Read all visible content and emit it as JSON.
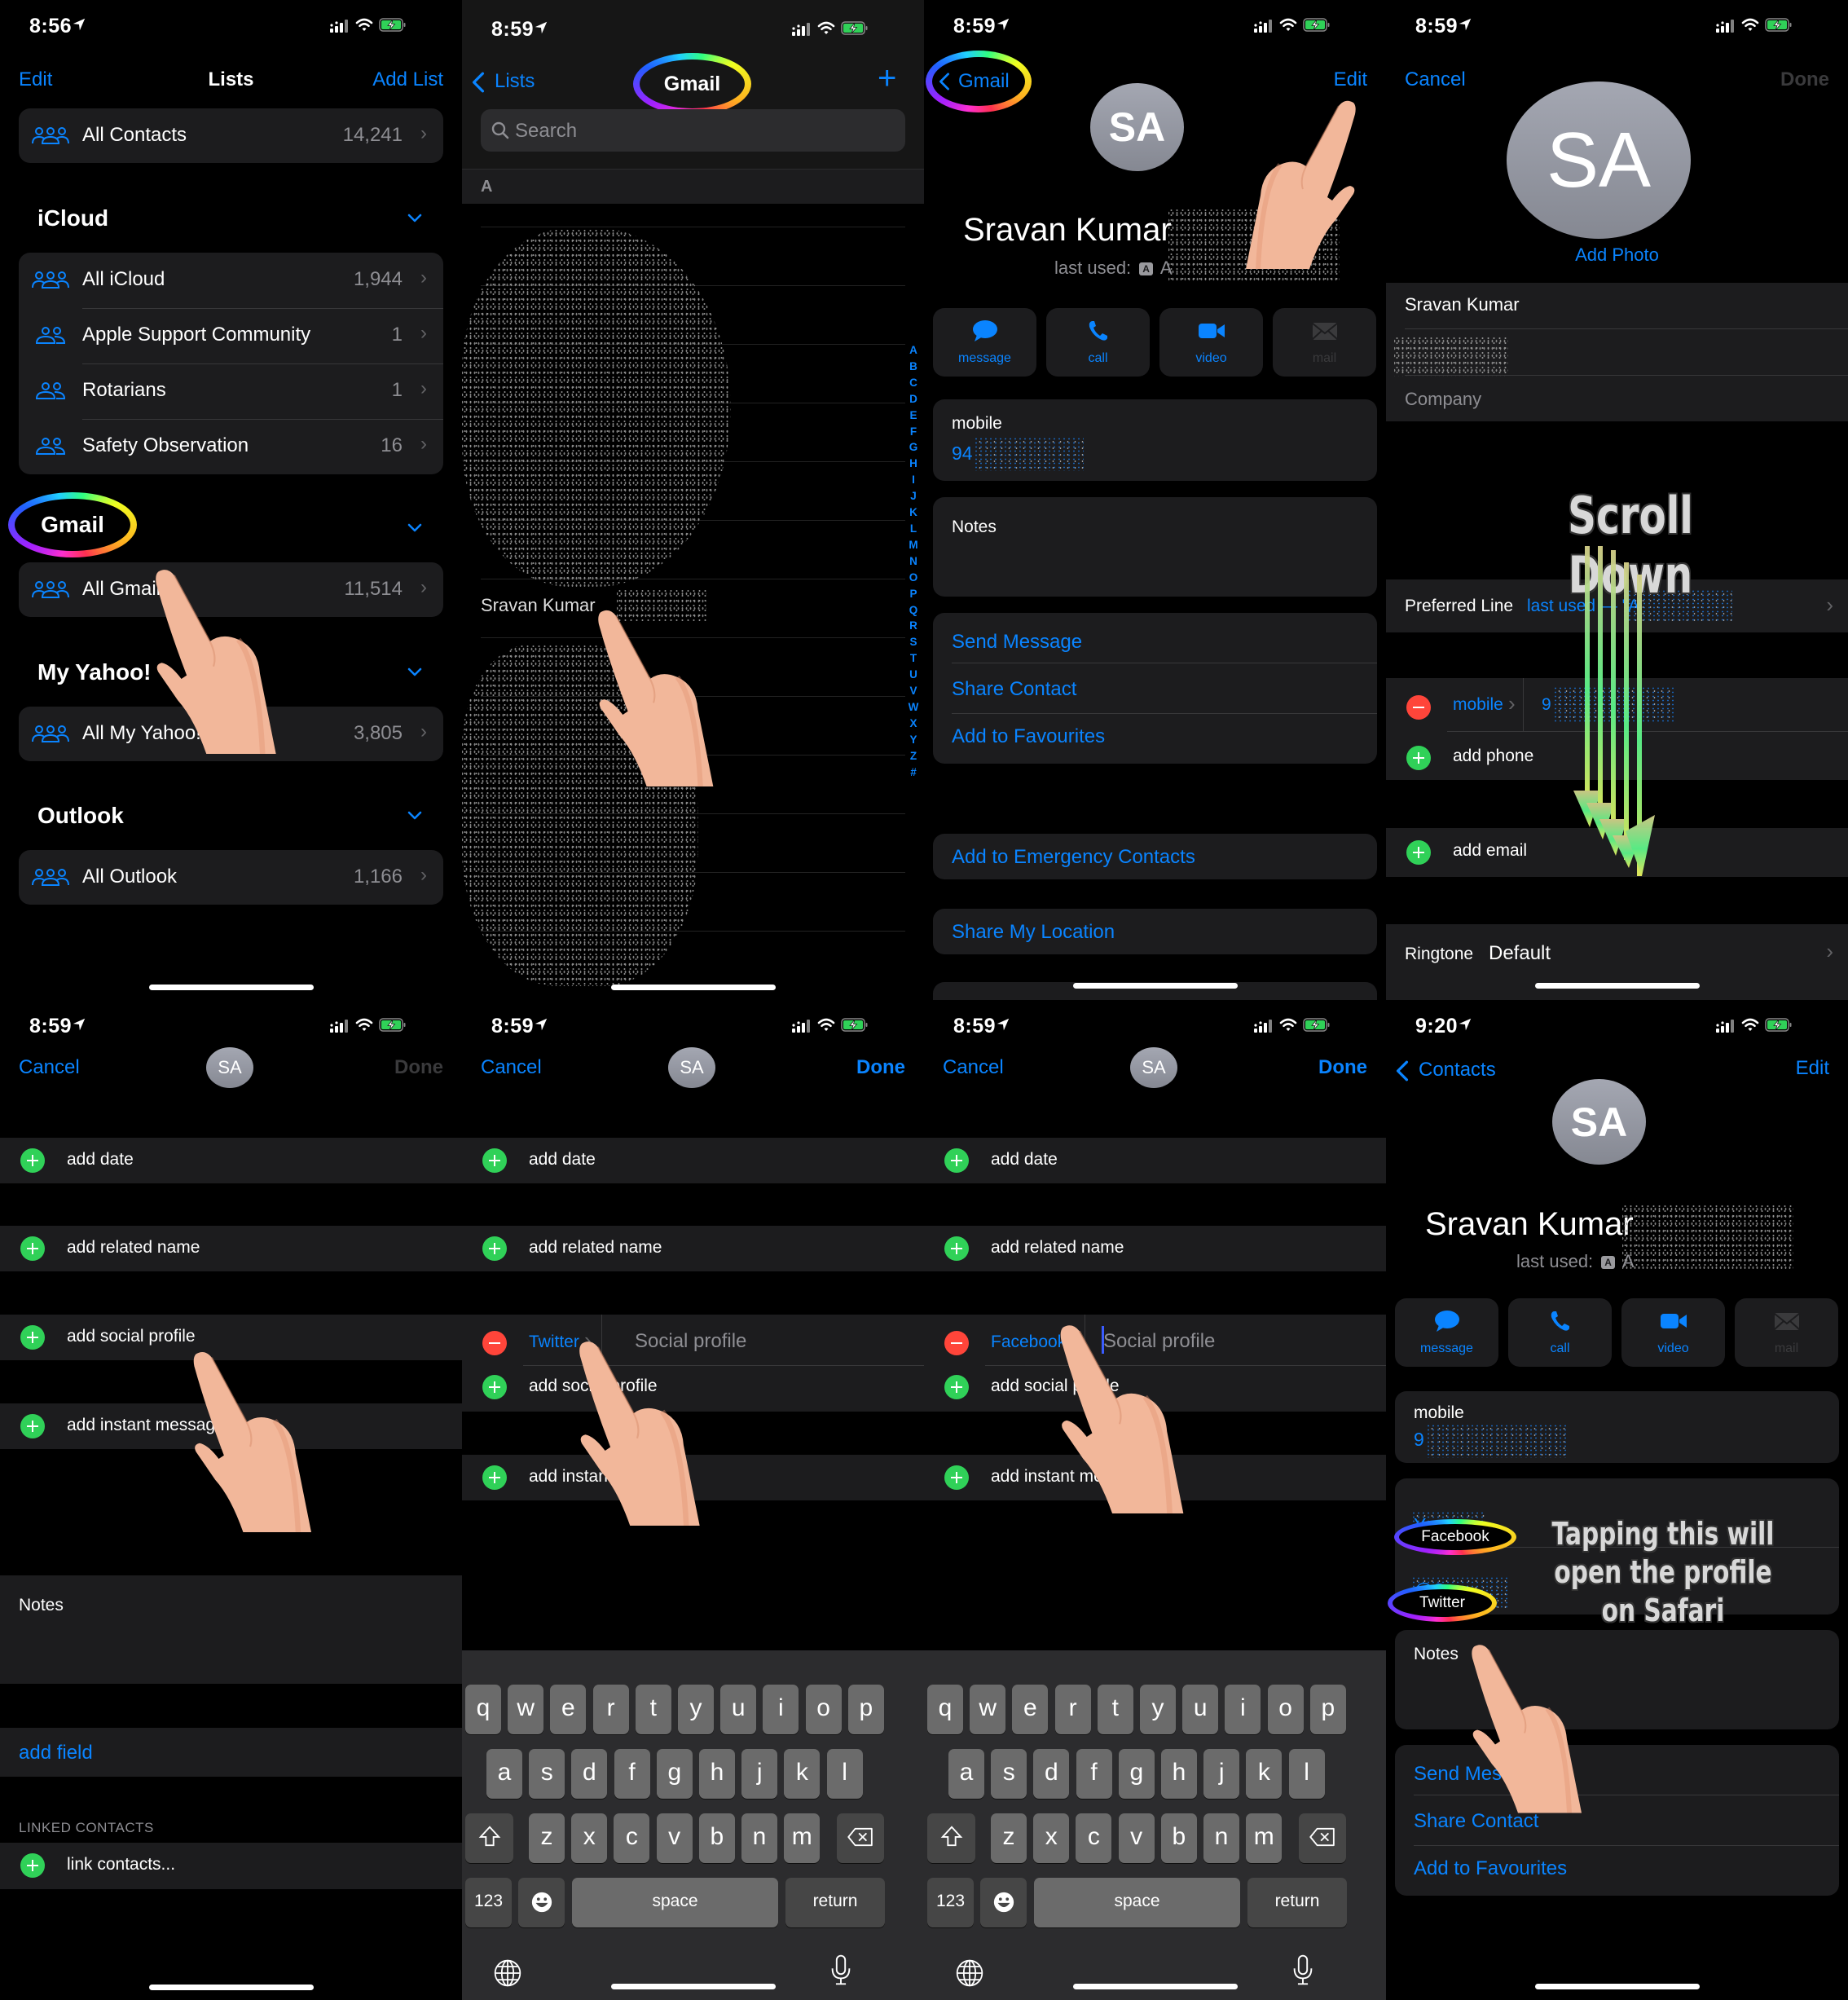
{
  "status_icons": [
    "location-arrow-icon",
    "cellular-signal-icon",
    "wifi-icon",
    "battery-charging-icon"
  ],
  "panel1": {
    "time": "8:56",
    "nav": {
      "left": "Edit",
      "title": "Lists",
      "right": "Add List"
    },
    "top_list": {
      "label": "All Contacts",
      "count": "14,241"
    },
    "sections": [
      {
        "title": "iCloud",
        "items": [
          {
            "label": "All iCloud",
            "count": "1,944",
            "icon": "group-icon"
          },
          {
            "label": "Apple Support Community",
            "count": "1",
            "icon": "group-icon"
          },
          {
            "label": "Rotarians",
            "count": "1",
            "icon": "group-icon"
          },
          {
            "label": "Safety Observation",
            "count": "16",
            "icon": "group-icon"
          }
        ]
      },
      {
        "title": "Gmail",
        "highlighted": true,
        "items": [
          {
            "label": "All Gmail",
            "count": "11,514",
            "icon": "group-icon"
          }
        ]
      },
      {
        "title": "My Yahoo!",
        "items": [
          {
            "label": "All My Yahoo!",
            "count": "3,805",
            "icon": "group-icon"
          }
        ]
      },
      {
        "title": "Outlook",
        "items": [
          {
            "label": "All Outlook",
            "count": "1,166",
            "icon": "group-icon"
          }
        ]
      }
    ]
  },
  "panel2": {
    "time": "8:59",
    "nav": {
      "back": "Lists",
      "title": "Gmail",
      "add": "+"
    },
    "search_placeholder": "Search",
    "section_letter": "A",
    "highlighted_contact": "Sravan Kumar",
    "index_letters": [
      "A",
      "B",
      "C",
      "D",
      "E",
      "F",
      "G",
      "H",
      "I",
      "J",
      "K",
      "L",
      "M",
      "N",
      "O",
      "P",
      "Q",
      "R",
      "S",
      "T",
      "U",
      "V",
      "W",
      "X",
      "Y",
      "Z",
      "#"
    ]
  },
  "panel3": {
    "time": "8:59",
    "nav": {
      "back": "Gmail",
      "right": "Edit"
    },
    "avatar_initials": "SA",
    "name": "Sravan Kumar",
    "last_used_label": "last used:",
    "last_used_badge": "A",
    "last_used_value": "A",
    "actions": [
      {
        "label": "message",
        "icon": "message-bubble-icon",
        "enabled": true
      },
      {
        "label": "call",
        "icon": "phone-icon",
        "enabled": true
      },
      {
        "label": "video",
        "icon": "video-camera-icon",
        "enabled": true
      },
      {
        "label": "mail",
        "icon": "envelope-icon",
        "enabled": false
      }
    ],
    "phone_label": "mobile",
    "phone_value_visible": "94",
    "notes_label": "Notes",
    "links_group1": [
      "Send Message",
      "Share Contact",
      "Add to Favourites"
    ],
    "links_group2": [
      "Add to Emergency Contacts"
    ],
    "links_group3": [
      "Share My Location"
    ]
  },
  "panel4": {
    "time": "8:59",
    "nav": {
      "left": "Cancel",
      "right": "Done"
    },
    "avatar_initials": "SA",
    "add_photo": "Add Photo",
    "first_name": "Sravan Kumar",
    "company_placeholder": "Company",
    "preferred_line_label": "Preferred Line",
    "preferred_line_value": "last used — \"A",
    "phone_type": "mobile",
    "phone_value_visible": "9",
    "add_phone": "add phone",
    "add_email": "add email",
    "ringtone_label": "Ringtone",
    "ringtone_value": "Default",
    "overlay": "Scroll Down"
  },
  "panel5": {
    "time": "8:59",
    "nav": {
      "left": "Cancel",
      "right": "Done"
    },
    "avatar_initials": "SA",
    "rows": [
      "add date",
      "add related name",
      "add social profile",
      "add instant message"
    ],
    "notes_label": "Notes",
    "add_field": "add field",
    "linked_header": "LINKED CONTACTS",
    "link_contacts": "link contacts..."
  },
  "panel6": {
    "time": "8:59",
    "nav": {
      "left": "Cancel",
      "right": "Done"
    },
    "avatar_initials": "SA",
    "rows_top": [
      "add date",
      "add related name"
    ],
    "social_type": "Twitter",
    "social_placeholder": "Social profile",
    "add_social": "add social profile",
    "add_im": "add instant message"
  },
  "panel7": {
    "time": "8:59",
    "nav": {
      "left": "Cancel",
      "right": "Done"
    },
    "avatar_initials": "SA",
    "rows_top": [
      "add date",
      "add related name"
    ],
    "social_type": "Facebook",
    "social_placeholder": "Social profile",
    "add_social": "add social profile",
    "add_im": "add instant message"
  },
  "keyboard": {
    "row1": [
      "q",
      "w",
      "e",
      "r",
      "t",
      "y",
      "u",
      "i",
      "o",
      "p"
    ],
    "row2": [
      "a",
      "s",
      "d",
      "f",
      "g",
      "h",
      "j",
      "k",
      "l"
    ],
    "row3": [
      "z",
      "x",
      "c",
      "v",
      "b",
      "n",
      "m"
    ],
    "numbers": "123",
    "space": "space",
    "return": "return",
    "icons": [
      "shift-icon",
      "delete-icon",
      "emoji-icon",
      "globe-icon",
      "microphone-icon"
    ]
  },
  "panel8": {
    "time": "9:20",
    "nav": {
      "back": "Contacts",
      "right": "Edit"
    },
    "avatar_initials": "SA",
    "name": "Sravan Kumar",
    "last_used_label": "last used:",
    "last_used_badge": "A",
    "last_used_value": "A",
    "actions": [
      {
        "label": "message",
        "enabled": true
      },
      {
        "label": "call",
        "enabled": true
      },
      {
        "label": "video",
        "enabled": true
      },
      {
        "label": "mail",
        "enabled": false
      }
    ],
    "phone_label": "mobile",
    "phone_value_visible": "9",
    "social": [
      {
        "label": "Facebook",
        "value_visible": "Ye"
      },
      {
        "label": "Twitter",
        "value_visible": "@S"
      }
    ],
    "notes_label": "Notes",
    "links": [
      "Send Message",
      "Share Contact",
      "Add to Favourites"
    ],
    "overlay": "Tapping this will open the profile on Safari"
  },
  "colors": {
    "accent": "#0a84ff",
    "add": "#30d158",
    "remove": "#ff453a",
    "cell": "#1c1c1e",
    "background": "#000000"
  }
}
